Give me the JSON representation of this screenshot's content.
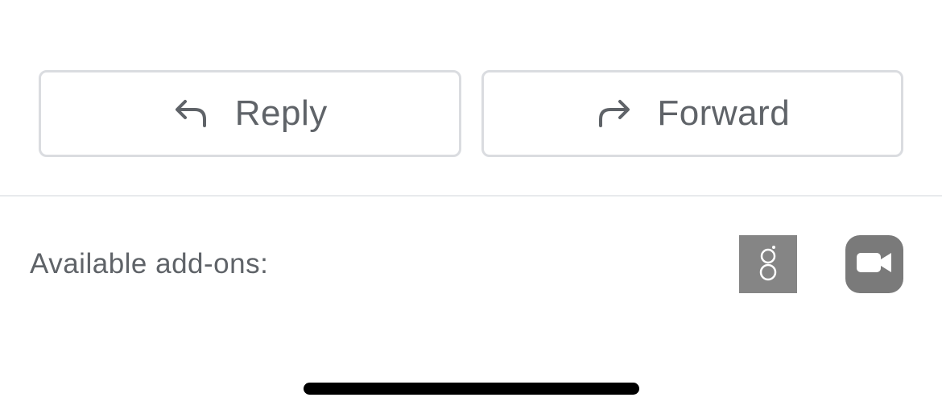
{
  "actions": {
    "reply": {
      "label": "Reply",
      "icon": "reply-icon"
    },
    "forward": {
      "label": "Forward",
      "icon": "forward-icon"
    }
  },
  "addons": {
    "label": "Available add-ons:",
    "items": [
      {
        "name": "g-addon",
        "icon": "g-logo-icon",
        "color": "#858585"
      },
      {
        "name": "video-meeting-addon",
        "icon": "video-camera-icon",
        "color": "#7a7a7a"
      }
    ]
  },
  "colors": {
    "text": "#5f6368",
    "border": "#dadce0",
    "divider": "#e8eaed"
  }
}
